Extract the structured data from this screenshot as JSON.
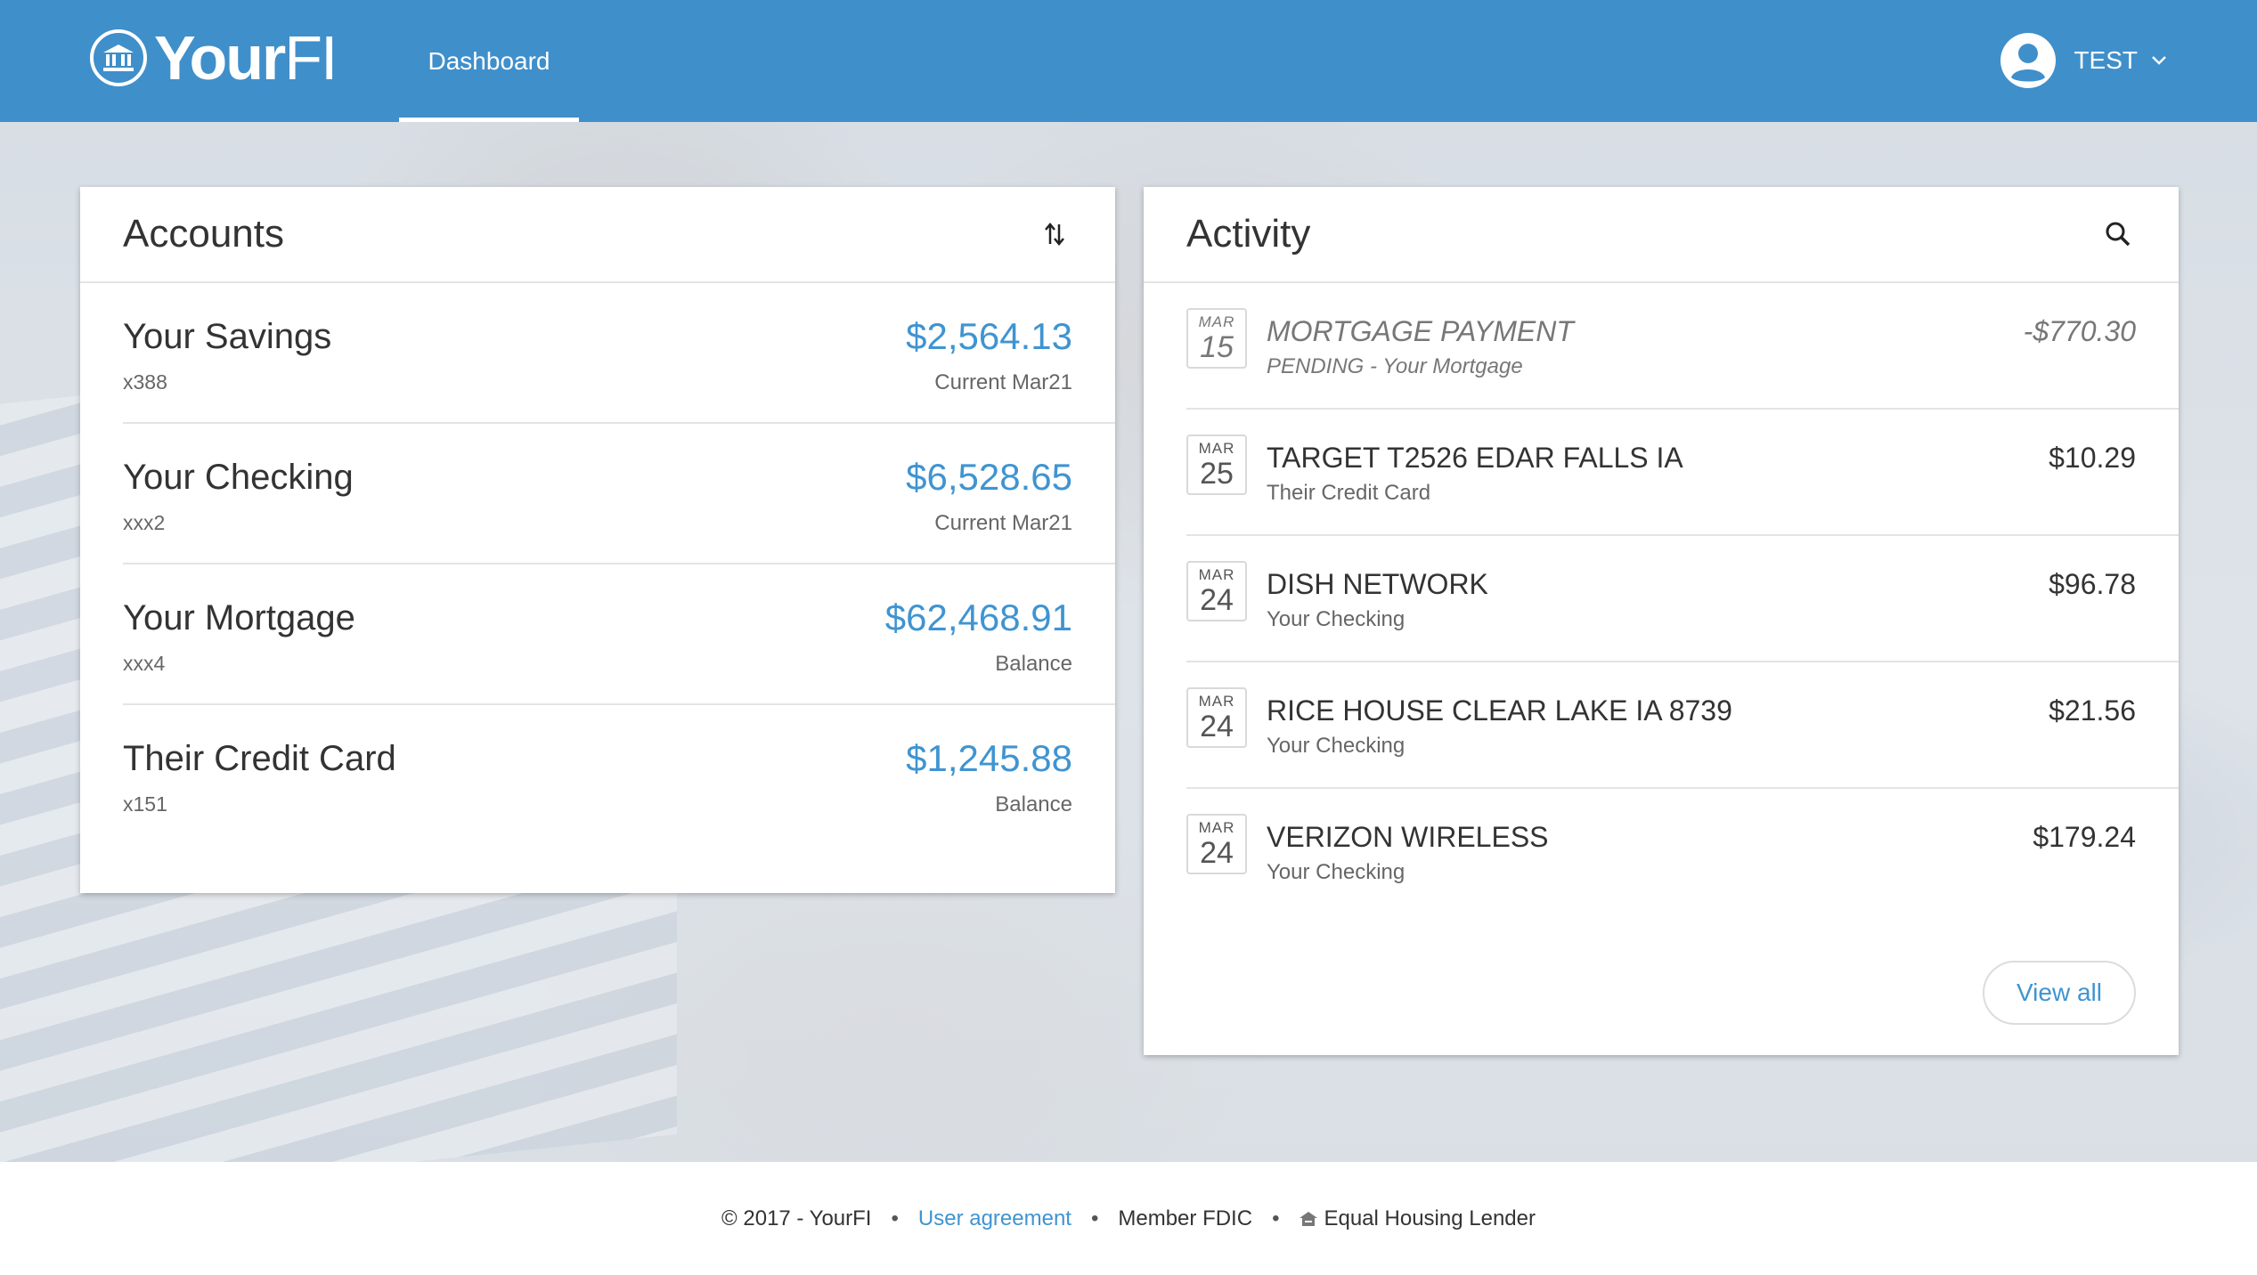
{
  "header": {
    "logo_bold": "Your",
    "logo_light": "FI",
    "nav_tab": "Dashboard",
    "user_name": "TEST"
  },
  "accounts": {
    "title": "Accounts",
    "items": [
      {
        "name": "Your Savings",
        "number": "x388",
        "amount": "$2,564.13",
        "sub": "Current Mar21"
      },
      {
        "name": "Your Checking",
        "number": "xxx2",
        "amount": "$6,528.65",
        "sub": "Current Mar21"
      },
      {
        "name": "Your Mortgage",
        "number": "xxx4",
        "amount": "$62,468.91",
        "sub": "Balance"
      },
      {
        "name": "Their Credit Card",
        "number": "x151",
        "amount": "$1,245.88",
        "sub": "Balance"
      }
    ]
  },
  "activity": {
    "title": "Activity",
    "items": [
      {
        "month": "MAR",
        "day": "15",
        "description": "MORTGAGE PAYMENT",
        "account": "PENDING - Your Mortgage",
        "amount": "-$770.30"
      },
      {
        "month": "MAR",
        "day": "25",
        "description": "TARGET T2526 EDAR FALLS IA",
        "account": "Their Credit Card",
        "amount": "$10.29"
      },
      {
        "month": "MAR",
        "day": "24",
        "description": "DISH NETWORK",
        "account": "Your Checking",
        "amount": "$96.78"
      },
      {
        "month": "MAR",
        "day": "24",
        "description": "RICE HOUSE CLEAR LAKE IA 8739",
        "account": "Your Checking",
        "amount": "$21.56"
      },
      {
        "month": "MAR",
        "day": "24",
        "description": "VERIZON WIRELESS",
        "account": "Your Checking",
        "amount": "$179.24"
      }
    ],
    "view_all": "View all"
  },
  "footer": {
    "copyright": "© 2017 - YourFI",
    "bullet": "•",
    "user_agreement": "User agreement",
    "member_fdic": "Member FDIC",
    "equal_housing": "Equal Housing Lender"
  },
  "colors": {
    "header_bg": "#3f8fcb",
    "accent": "#3f94d1"
  },
  "icons": [
    "bank-icon",
    "user-avatar-icon",
    "chevron-down-icon",
    "sort-icon",
    "search-icon",
    "house-icon"
  ]
}
